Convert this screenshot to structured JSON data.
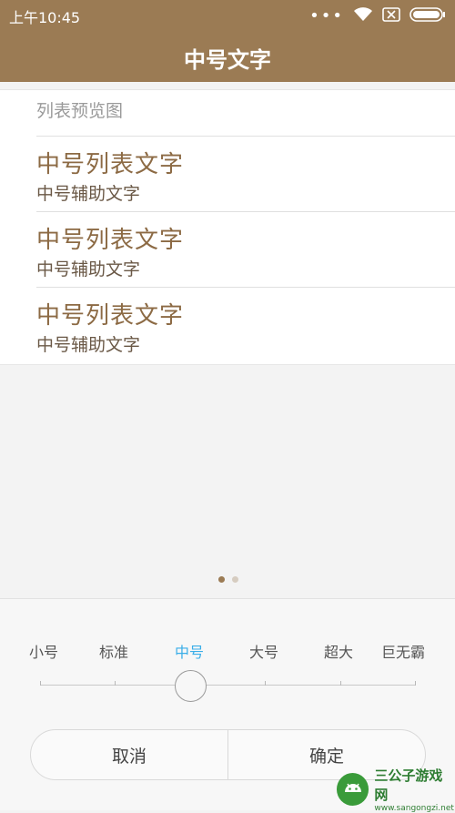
{
  "status_bar": {
    "time": "上午10:45",
    "icons": [
      "more-dots-icon",
      "wifi-icon",
      "sim-card-icon",
      "battery-icon"
    ]
  },
  "header": {
    "title": "中号文字"
  },
  "preview": {
    "header": "列表预览图",
    "items": [
      {
        "title": "中号列表文字",
        "subtitle": "中号辅助文字"
      },
      {
        "title": "中号列表文字",
        "subtitle": "中号辅助文字"
      },
      {
        "title": "中号列表文字",
        "subtitle": "中号辅助文字"
      }
    ]
  },
  "pager": {
    "total": 2,
    "active": 1
  },
  "font_size_selector": {
    "options": [
      "小号",
      "标准",
      "中号",
      "大号",
      "超大",
      "巨无霸"
    ],
    "selected_index": 2
  },
  "buttons": {
    "cancel": "取消",
    "confirm": "确定"
  },
  "watermark": {
    "name": "三公子游戏网",
    "url": "www.sangongzi.net"
  },
  "colors": {
    "brand": "#9b7b54",
    "item_title": "#8c6a44",
    "active_option": "#3aaee8"
  }
}
